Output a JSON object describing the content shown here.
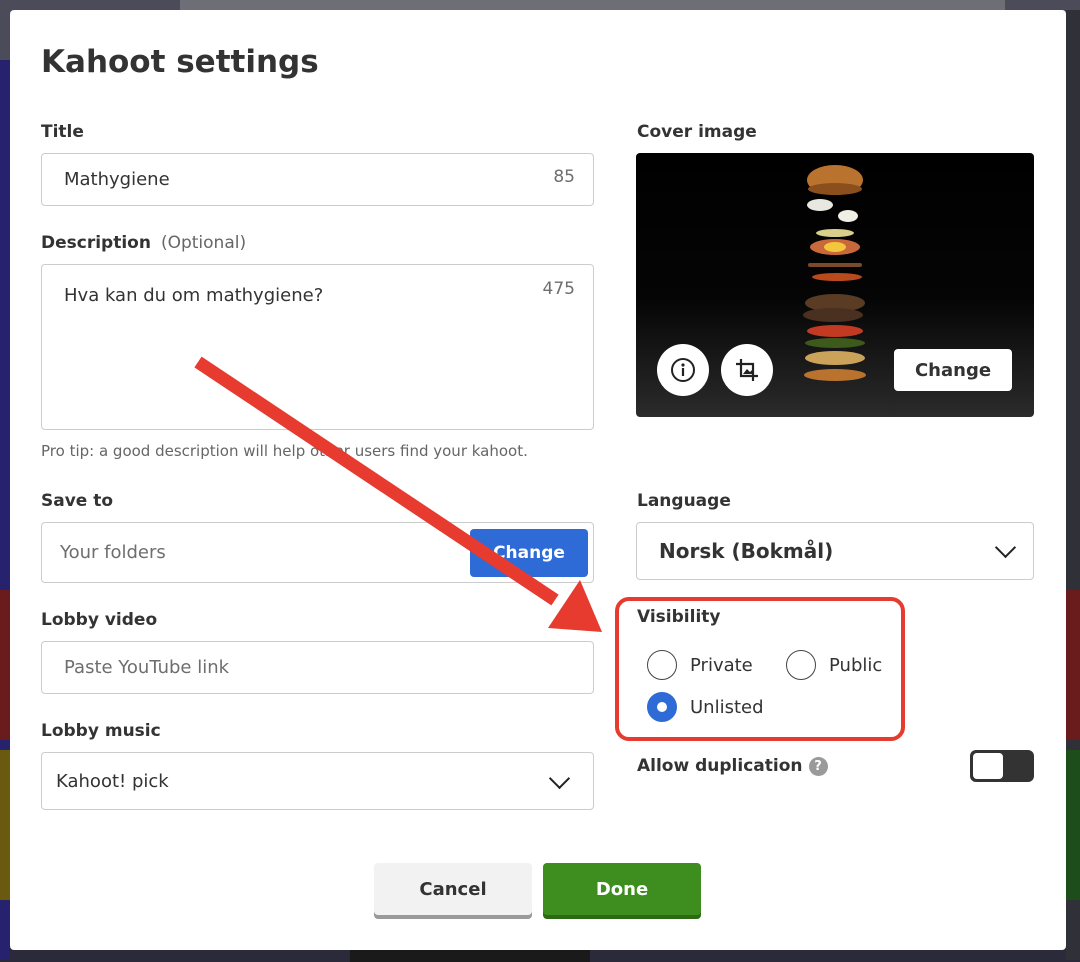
{
  "modal": {
    "title": "Kahoot settings"
  },
  "title_field": {
    "label": "Title",
    "value": "Mathygiene",
    "counter": "85"
  },
  "description_field": {
    "label": "Description",
    "optional": "(Optional)",
    "value": "Hva kan du om mathygiene?",
    "counter": "475",
    "tip": "Pro tip: a good description will help other users find your kahoot."
  },
  "cover_image": {
    "label": "Cover image",
    "change_label": "Change",
    "info_icon": "info-icon",
    "crop_icon": "crop-image-icon"
  },
  "save_to": {
    "label": "Save to",
    "placeholder": "Your folders",
    "change_label": "Change"
  },
  "language": {
    "label": "Language",
    "selected": "Norsk (Bokmål)"
  },
  "lobby_video": {
    "label": "Lobby video",
    "placeholder": "Paste YouTube link"
  },
  "lobby_music": {
    "label": "Lobby music",
    "selected": "Kahoot! pick"
  },
  "visibility": {
    "label": "Visibility",
    "options": [
      {
        "label": "Private",
        "selected": false
      },
      {
        "label": "Public",
        "selected": false
      },
      {
        "label": "Unlisted",
        "selected": true
      }
    ]
  },
  "allow_duplication": {
    "label": "Allow duplication",
    "help": "?",
    "enabled": false
  },
  "footer": {
    "cancel_label": "Cancel",
    "done_label": "Done"
  },
  "colors": {
    "primary_blue": "#2e6bd6",
    "done_green": "#3e8e1f",
    "annotation_red": "#e63b2e"
  }
}
